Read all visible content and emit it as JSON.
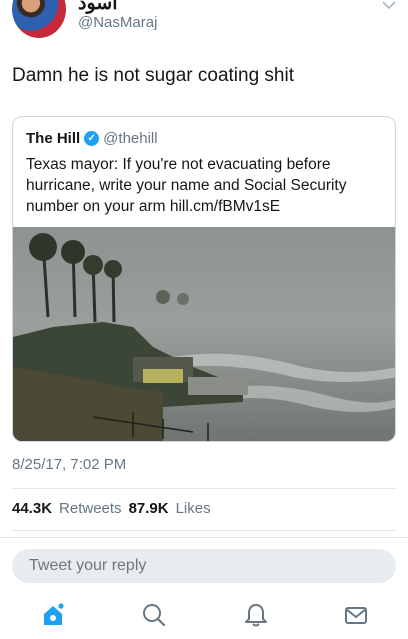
{
  "tweet": {
    "author_name": "أسود",
    "author_handle": "@NasMaraj",
    "text": "Damn he is not sugar coating shit",
    "timestamp": "8/25/17, 7:02 PM",
    "retweets_count": "44.3K",
    "retweets_label": "Retweets",
    "likes_count": "87.9K",
    "likes_label": "Likes"
  },
  "quoted": {
    "name": "The Hill",
    "handle": "@thehill",
    "text": "Texas mayor: If you're not evacuating before hurricane, write your name and Social Security number on your arm hill.cm/fBMv1sE"
  },
  "reply": {
    "placeholder": "Tweet your reply"
  },
  "nav": {
    "tabs": [
      "home-icon",
      "search-icon",
      "notifications-icon",
      "messages-icon"
    ],
    "active": "home-icon"
  },
  "colors": {
    "accent": "#1da1f2",
    "muted": "#657786",
    "border": "#e1e8ed"
  }
}
